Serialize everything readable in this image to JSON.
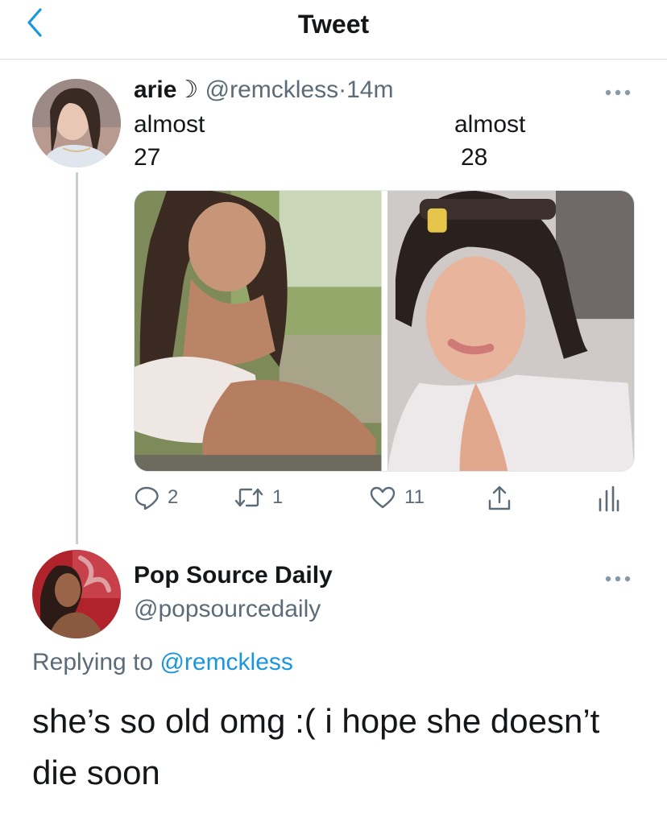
{
  "header": {
    "title": "Tweet",
    "back_icon": "chevron-left-icon"
  },
  "colors": {
    "accent": "#1b95e0",
    "secondary_text": "#5b6b78",
    "divider": "#d8dde1"
  },
  "tweet": {
    "display_name": "arie☽",
    "handle": "@remckless",
    "separator": "·",
    "time": "14m",
    "caption_left_line1": "almost",
    "caption_left_line2": "27",
    "caption_right_line1": "almost",
    "caption_right_line2": "28",
    "photos": [
      "photo-left",
      "photo-right"
    ],
    "actions": {
      "reply_count": "2",
      "retweet_count": "1",
      "like_count": "11"
    }
  },
  "reply": {
    "display_name": "Pop Source Daily",
    "handle": "@popsourcedaily",
    "replying_prefix": "Replying to",
    "replying_to": "@remckless",
    "text": "she’s so old omg :( i hope she doesn’t die soon"
  }
}
